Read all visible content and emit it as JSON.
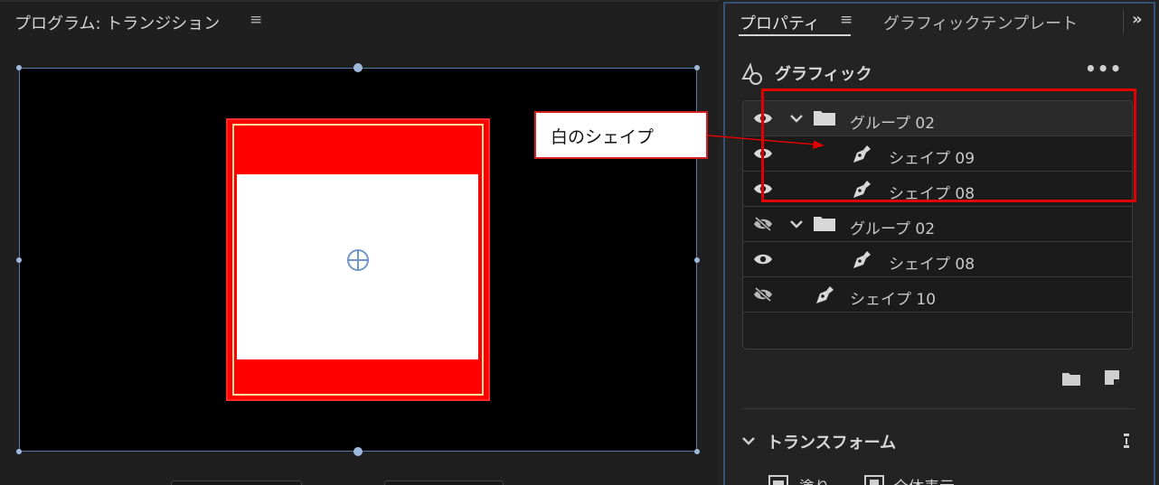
{
  "program_monitor": {
    "title": "プログラム: トランジション",
    "menu_icon": "hamburger-menu-icon"
  },
  "properties_panel": {
    "tabs": [
      {
        "label": "プロパティ",
        "active": true
      },
      {
        "label": "グラフィックテンプレート",
        "active": false
      }
    ],
    "tab_menu_icon": "hamburger-menu-icon",
    "overflow_icon": "double-chevron-right-icon",
    "graphic_section": {
      "title": "グラフィック",
      "icon": "graphic-shapes-icon",
      "more_icon": "ellipsis-icon"
    },
    "layers": [
      {
        "type": "group",
        "label": "グループ 02",
        "visible": true
      },
      {
        "type": "shape",
        "label": "シェイプ 09",
        "visible": true
      },
      {
        "type": "shape",
        "label": "シェイプ 08",
        "visible": true
      },
      {
        "type": "group",
        "label": "グループ 02",
        "visible": false
      },
      {
        "type": "shape",
        "label": "シェイプ 08",
        "visible": true
      },
      {
        "type": "shape",
        "label": "シェイプ 10",
        "visible": false
      }
    ],
    "transform_section": {
      "title": "トランスフォーム",
      "fill_label": "塗り",
      "visible_label": "全体表示"
    }
  },
  "annotation": {
    "callout_text": "白のシェイプ",
    "highlight_color": "#e00000"
  },
  "colors": {
    "shape_red": "#ff0000",
    "shape_white": "#ffffff",
    "selection_blue": "#5a7aa8",
    "panel_focus_border": "#345277"
  }
}
